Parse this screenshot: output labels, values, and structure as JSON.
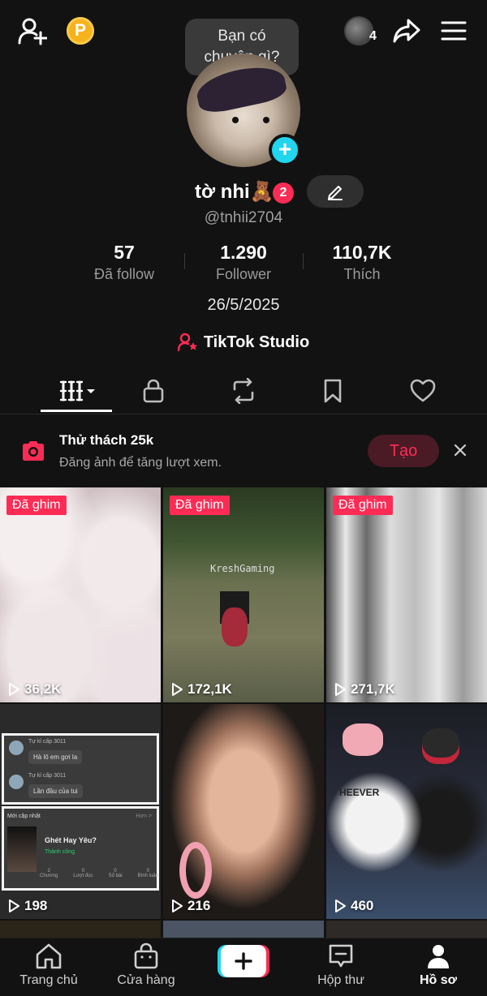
{
  "top_bar": {
    "add_friend_icon": "person-add-icon",
    "coin_label": "P",
    "visitor_count": "4",
    "share_icon": "share-arrow-icon",
    "menu_icon": "hamburger-menu-icon"
  },
  "story_bubble": {
    "line1": "Bạn có",
    "line2": "chuyện gì?"
  },
  "profile": {
    "display_name": "tờ nhi🧸",
    "level": "2",
    "username": "@tnhii2704",
    "bio": "26/5/2025",
    "studio_link": "TikTok Studio"
  },
  "stats": {
    "following": {
      "value": "57",
      "label": "Đã follow"
    },
    "followers": {
      "value": "1.290",
      "label": "Follower"
    },
    "likes": {
      "value": "110,7K",
      "label": "Thích"
    }
  },
  "tabs": [
    "videos",
    "private",
    "reposts",
    "saved",
    "liked"
  ],
  "challenge": {
    "title": "Thử thách 25k",
    "subtitle": "Đăng ảnh để tăng lượt xem.",
    "button": "Tạo"
  },
  "videos": [
    {
      "pinned": "Đã ghim",
      "views": "36,2K"
    },
    {
      "pinned": "Đã ghim",
      "views": "172,1K",
      "overlay_text": "KreshGaming"
    },
    {
      "pinned": "Đã ghim",
      "views": "271,7K"
    },
    {
      "views": "198",
      "chat": {
        "m1_meta": "Tự kỉ cấp 3011",
        "m1": "Hà lô em gơi la",
        "m2_meta": "Tự kỉ cấp 3011",
        "m2": "Lần đầu của tui",
        "section": "Mới cập nhật",
        "more": "Hơn >",
        "song": "Ghét Hay Yêu?",
        "status": "Thành công",
        "s1": "2",
        "s1l": "Chương",
        "s2": "0",
        "s2l": "Lượt đọc",
        "s3": "0",
        "s3l": "Số bài",
        "s4": "0",
        "s4l": "Bình luận"
      }
    },
    {
      "views": "216"
    },
    {
      "views": "460",
      "shirt_text": "HEEVER"
    }
  ],
  "bottom_nav": {
    "home": "Trang chủ",
    "shop": "Cửa hàng",
    "inbox": "Hộp thư",
    "profile": "Hồ sơ"
  },
  "colors": {
    "accent": "#fe2c55",
    "cyan": "#20d5ec",
    "background": "#121212"
  }
}
